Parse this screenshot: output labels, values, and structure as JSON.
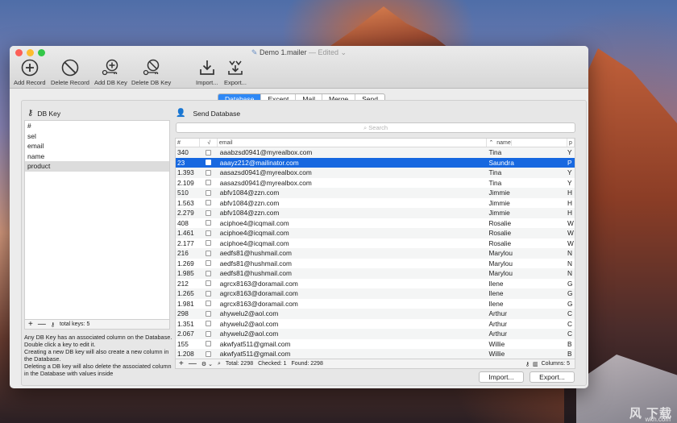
{
  "window": {
    "title": "Demo 1.mailer",
    "edited": "— Edited ⌄"
  },
  "toolbar": [
    {
      "label": "Add Record",
      "icon": "plus-circle-icon"
    },
    {
      "label": "Delete Record",
      "icon": "no-sign-icon"
    },
    {
      "label": "Add DB Key",
      "icon": "add-key-icon"
    },
    {
      "label": "Delete DB Key",
      "icon": "delete-key-icon"
    },
    {
      "label": "Import...",
      "icon": "import-icon"
    },
    {
      "label": "Export...",
      "icon": "export-icon"
    }
  ],
  "tabs": [
    "Database",
    "Except",
    "Mail",
    "Merge",
    "Send"
  ],
  "active_tab": "Database",
  "left": {
    "header": "DB Key",
    "keys": [
      "#",
      "sel",
      "email",
      "name",
      "product"
    ],
    "selected_key": "product",
    "total_keys": "total keys: 5",
    "help": [
      "Any DB Key has an associated column on the Database. Double click a key to edit it.",
      "Creating a new DB key will also create a new column in the Database.",
      "Deleting a DB key will also delete the associated column in the Database with values inside"
    ]
  },
  "right": {
    "header": "Send Database",
    "search_placeholder": "Search",
    "columns": [
      "#",
      "√",
      "email",
      "name",
      "p"
    ],
    "rows": [
      {
        "num": "340",
        "email": "aaabzsd0941@myrealbox.com",
        "name": "Tina",
        "p": "Y"
      },
      {
        "num": "23",
        "email": "aaayz212@mailinator.com",
        "name": "Saundra",
        "p": "P",
        "selected": true
      },
      {
        "num": "1.393",
        "email": "aasazsd0941@myrealbox.com",
        "name": "Tina",
        "p": "Y"
      },
      {
        "num": "2.109",
        "email": "aasazsd0941@myrealbox.com",
        "name": "Tina",
        "p": "Y"
      },
      {
        "num": "510",
        "email": "abfv1084@zzn.com",
        "name": "Jimmie",
        "p": "H"
      },
      {
        "num": "1.563",
        "email": "abfv1084@zzn.com",
        "name": "Jimmie",
        "p": "H"
      },
      {
        "num": "2.279",
        "email": "abfv1084@zzn.com",
        "name": "Jimmie",
        "p": "H"
      },
      {
        "num": "408",
        "email": "aciphoe4@icqmail.com",
        "name": "Rosalie",
        "p": "W"
      },
      {
        "num": "1.461",
        "email": "aciphoe4@icqmail.com",
        "name": "Rosalie",
        "p": "W"
      },
      {
        "num": "2.177",
        "email": "aciphoe4@icqmail.com",
        "name": "Rosalie",
        "p": "W"
      },
      {
        "num": "216",
        "email": "aedfs81@hushmail.com",
        "name": "Marylou",
        "p": "N"
      },
      {
        "num": "1.269",
        "email": "aedfs81@hushmail.com",
        "name": "Marylou",
        "p": "N"
      },
      {
        "num": "1.985",
        "email": "aedfs81@hushmail.com",
        "name": "Marylou",
        "p": "N"
      },
      {
        "num": "212",
        "email": "agrcx8163@doramail.com",
        "name": "Ilene",
        "p": "G"
      },
      {
        "num": "1.265",
        "email": "agrcx8163@doramail.com",
        "name": "Ilene",
        "p": "G"
      },
      {
        "num": "1.981",
        "email": "agrcx8163@doramail.com",
        "name": "Ilene",
        "p": "G"
      },
      {
        "num": "298",
        "email": "ahywelu2@aol.com",
        "name": "Arthur",
        "p": "C"
      },
      {
        "num": "1.351",
        "email": "ahywelu2@aol.com",
        "name": "Arthur",
        "p": "C"
      },
      {
        "num": "2.067",
        "email": "ahywelu2@aol.com",
        "name": "Arthur",
        "p": "C"
      },
      {
        "num": "155",
        "email": "akwfyat511@gmail.com",
        "name": "Willie",
        "p": "B"
      },
      {
        "num": "1.208",
        "email": "akwfyat511@gmail.com",
        "name": "Willie",
        "p": "B"
      }
    ],
    "footer": {
      "total": "Total: 2298",
      "checked": "Checked: 1",
      "found": "Found: 2298",
      "columns": "Columns: 5"
    }
  },
  "buttons": {
    "import": "Import...",
    "export": "Export..."
  },
  "watermark": {
    "big": "风 下载",
    "small": "wkh.com"
  },
  "colors": {
    "accent": "#2e88f6",
    "selection": "#1768e0"
  }
}
